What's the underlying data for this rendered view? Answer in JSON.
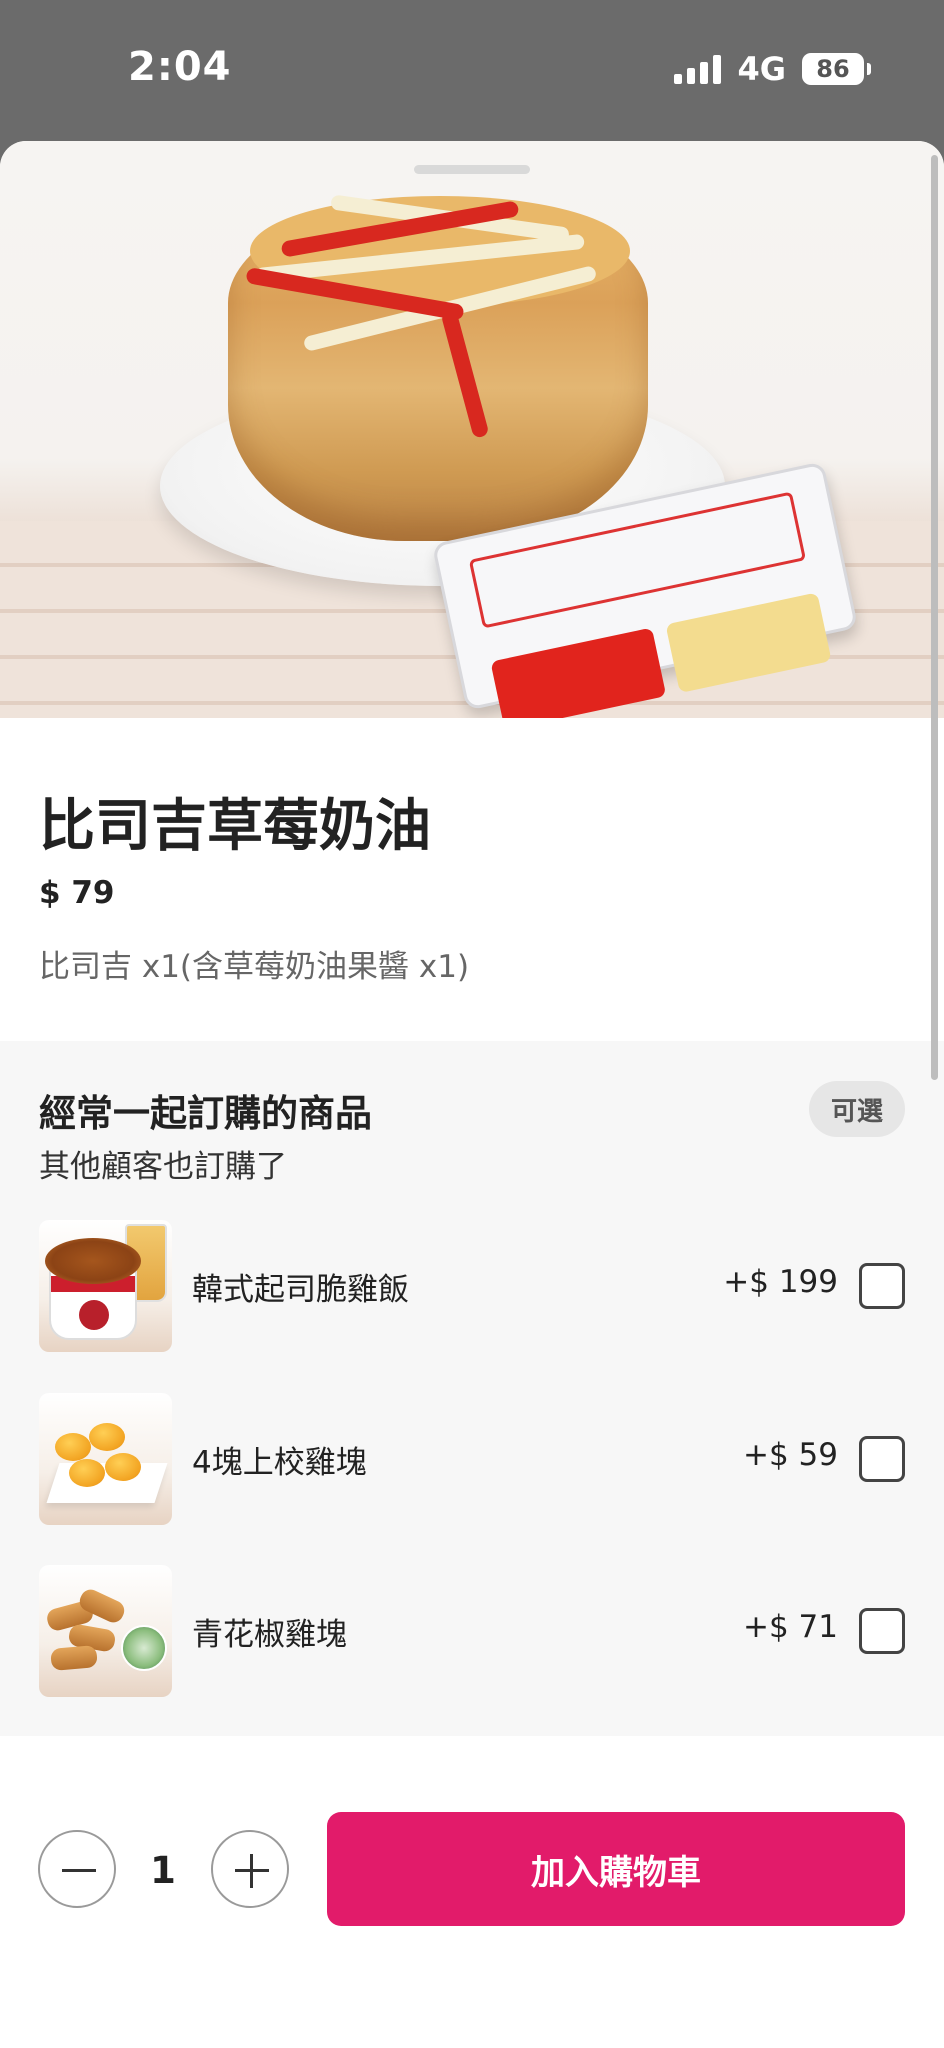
{
  "status_bar": {
    "time": "2:04",
    "network": "4G",
    "battery": "86"
  },
  "product": {
    "name": "比司吉草莓奶油",
    "price": "$ 79",
    "description": "比司吉 x1(含草莓奶油果醬 x1)",
    "image_icon": "biscuit-with-strawberry-cream-image"
  },
  "frequently_bought": {
    "title": "經常一起訂購的商品",
    "subtitle": "其他顧客也訂購了",
    "badge": "可選",
    "items": [
      {
        "name": "韓式起司脆雞飯",
        "price": "+$ 199",
        "checked": false
      },
      {
        "name": "4塊上校雞塊",
        "price": "+$ 59",
        "checked": false
      },
      {
        "name": "青花椒雞塊",
        "price": "+$ 71",
        "checked": false
      }
    ]
  },
  "cart_bar": {
    "quantity": "1",
    "add_to_cart_label": "加入購物車"
  },
  "colors": {
    "accent": "#e21b6a",
    "status_bar_bg": "#6b6b6b",
    "section_bg": "#f7f7f7"
  }
}
